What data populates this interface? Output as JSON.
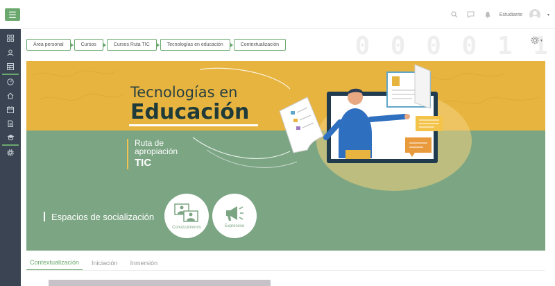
{
  "topbar": {
    "menu_icon": "hamburger-icon",
    "search_icon": "search-icon",
    "messages_icon": "chat-icon",
    "notifications_icon": "bell-icon",
    "user_name": "Estudiante",
    "user_caret": "▾"
  },
  "sidebar": {
    "items": [
      {
        "icon": "grid-icon"
      },
      {
        "icon": "user-group-icon"
      },
      {
        "icon": "table-icon"
      },
      {
        "icon": "dashboard-icon"
      },
      {
        "icon": "home-icon"
      },
      {
        "icon": "calendar-icon"
      },
      {
        "icon": "files-icon"
      },
      {
        "icon": "graduation-cap-icon"
      },
      {
        "icon": "settings-icon"
      }
    ]
  },
  "breadcrumb": {
    "items": [
      "Área personal",
      "Cursos",
      "Cursos Ruta TIC",
      "Tecnologías en educación",
      "Contextualización"
    ]
  },
  "page_actions": {
    "gear_icon": "gear-icon",
    "caret": "▾"
  },
  "banner": {
    "title_line1": "Tecnologías en",
    "title_line2": "Educación",
    "ruta_line1": "Ruta de",
    "ruta_line2": "apropiación",
    "ruta_line3": "TIC",
    "spaces_title": "Espacios de socialización",
    "circles": [
      {
        "label": "Conozcámonos",
        "icon": "photos-icon"
      },
      {
        "label": "Exprésese",
        "icon": "megaphone-icon"
      }
    ]
  },
  "tabs": [
    {
      "label": "Contextualización",
      "active": true
    },
    {
      "label": "Iniciación",
      "active": false
    },
    {
      "label": "Inmersión",
      "active": false
    }
  ],
  "colors": {
    "accent_green": "#6aa86e",
    "sidebar_dark": "#3a4452",
    "banner_yellow": "#e7b440",
    "banner_green": "#7ba583",
    "title_dark": "#1e3a39"
  },
  "background_digits": "0 0 0 0 1 1"
}
